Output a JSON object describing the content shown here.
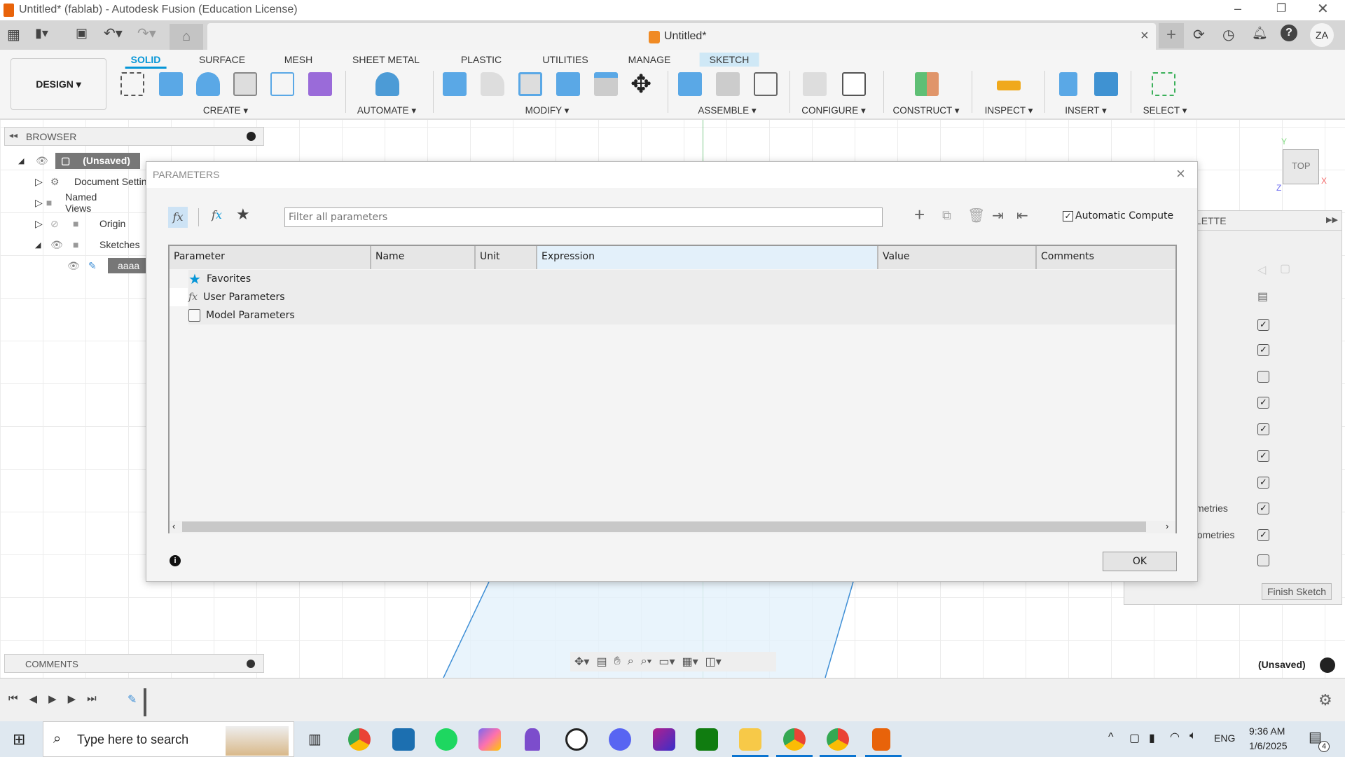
{
  "window": {
    "title": "Untitled* (fablab) - Autodesk Fusion (Education License)"
  },
  "document_tab": {
    "title": "Untitled*",
    "close": "×"
  },
  "user": {
    "initials": "ZA"
  },
  "ribbon": {
    "workspace": "DESIGN ▾",
    "tabs": [
      "SOLID",
      "SURFACE",
      "MESH",
      "SHEET METAL",
      "PLASTIC",
      "UTILITIES",
      "MANAGE",
      "SKETCH"
    ],
    "active_tab": "SOLID",
    "groups": [
      "CREATE ▾",
      "AUTOMATE ▾",
      "MODIFY ▾",
      "ASSEMBLE ▾",
      "CONFIGURE ▾",
      "CONSTRUCT ▾",
      "INSPECT ▾",
      "INSERT ▾",
      "SELECT ▾"
    ]
  },
  "browser": {
    "title": "BROWSER",
    "items": [
      {
        "label": "(Unsaved)"
      },
      {
        "label": "Document Settings"
      },
      {
        "label": "Named Views"
      },
      {
        "label": "Origin"
      },
      {
        "label": "Sketches"
      },
      {
        "label": "aaaa"
      }
    ]
  },
  "comments": {
    "title": "COMMENTS"
  },
  "viewcube": {
    "face": "TOP",
    "x": "X",
    "y": "Y",
    "z": "Z"
  },
  "palette": {
    "title": "LETTE",
    "rows": [
      {
        "label": "",
        "checked": true
      },
      {
        "label": "",
        "checked": true
      },
      {
        "label": "",
        "checked": false
      },
      {
        "label": "",
        "checked": true
      },
      {
        "label": "",
        "checked": true
      },
      {
        "label": "",
        "checked": true
      },
      {
        "label": "",
        "checked": true
      },
      {
        "label": "metries",
        "checked": true
      },
      {
        "label": "eometries",
        "checked": true
      },
      {
        "label": "",
        "checked": false
      }
    ],
    "finish": "Finish Sketch"
  },
  "status": {
    "doc": "(Unsaved)"
  },
  "dialog": {
    "title": "PARAMETERS",
    "filter_placeholder": "Filter all parameters",
    "auto_compute": "Automatic Compute",
    "auto_compute_checked": true,
    "columns": [
      "Parameter",
      "Name",
      "Unit",
      "Expression",
      "Value",
      "Comments"
    ],
    "rows": [
      {
        "label": "Favorites",
        "icon": "star-icon"
      },
      {
        "label": "User Parameters",
        "icon": "fx-icon"
      },
      {
        "label": "Model Parameters",
        "icon": "box-icon"
      }
    ],
    "ok": "OK"
  },
  "taskbar": {
    "search_placeholder": "Type here to search",
    "lang": "ENG",
    "time": "9:36 AM",
    "date": "1/6/2025",
    "notifications": "4"
  },
  "colors": {
    "accent": "#0696d7",
    "sketch_tab": "#cfe8f6",
    "ribbon_bg": "#f5f5f5"
  }
}
